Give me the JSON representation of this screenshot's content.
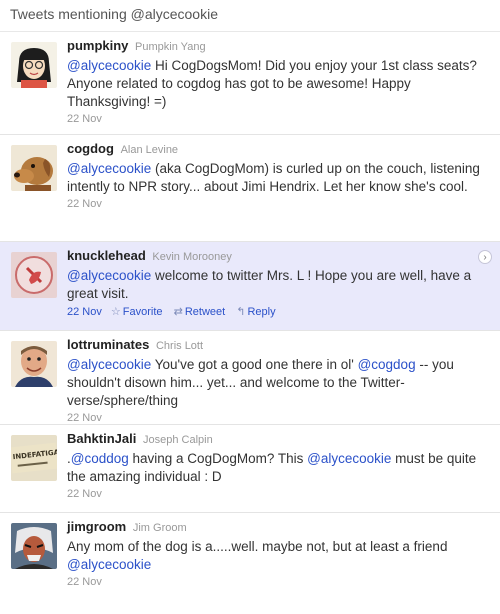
{
  "header": {
    "title": "Tweets mentioning @alycecookie"
  },
  "tweets": [
    {
      "screen_name": "pumpkiny",
      "full_name": "Pumpkin Yang",
      "mention": "@alycecookie",
      "text": " Hi CogDogsMom! Did you enjoy your 1st class seats? Anyone related to cogdog has got to be awesome! Happy Thanksgiving! =)",
      "time": "22 Nov"
    },
    {
      "screen_name": "cogdog",
      "full_name": "Alan Levine",
      "mention": "@alycecookie",
      "text": " (aka CogDogMom) is curled up on the couch, listening intently to NPR story... about Jimi Hendrix. Let her know she's cool.",
      "time": "22 Nov"
    },
    {
      "screen_name": "knucklehead",
      "full_name": "Kevin Morooney",
      "mention": "@alycecookie",
      "text": " welcome to twitter Mrs. L ! Hope you are well, have a great visit.",
      "time": "22 Nov",
      "actions": {
        "favorite": "Favorite",
        "retweet": "Retweet",
        "reply": "Reply"
      },
      "arrow": "›"
    },
    {
      "screen_name": "lottruminates",
      "full_name": "Chris Lott",
      "mention": "@alycecookie",
      "text_a": " You've got a good one there in ol' ",
      "mention_b": "@cogdog",
      "text_b": " -- you shouldn't disown him... yet... and welcome to the Twitter-verse/sphere/thing",
      "time": "22 Nov"
    },
    {
      "screen_name": "BahktinJali",
      "full_name": "Joseph Calpin",
      "prefix": ".",
      "mention": "@coddog",
      "text_a": " having a CogDogMom? This ",
      "mention_b": "@alycecookie",
      "text_b": " must be quite the amazing individual : D",
      "time": "22 Nov",
      "avatar_text": "INDEFATIGABL"
    },
    {
      "screen_name": "jimgroom",
      "full_name": "Jim Groom",
      "text": "Any mom of the dog is a.....well. maybe not, but at least a friend ",
      "mention": "@alycecookie",
      "time": "22 Nov"
    }
  ],
  "colors": {
    "link": "#2b51c9",
    "highlight": "#e9e9fb",
    "muted": "#999999"
  }
}
